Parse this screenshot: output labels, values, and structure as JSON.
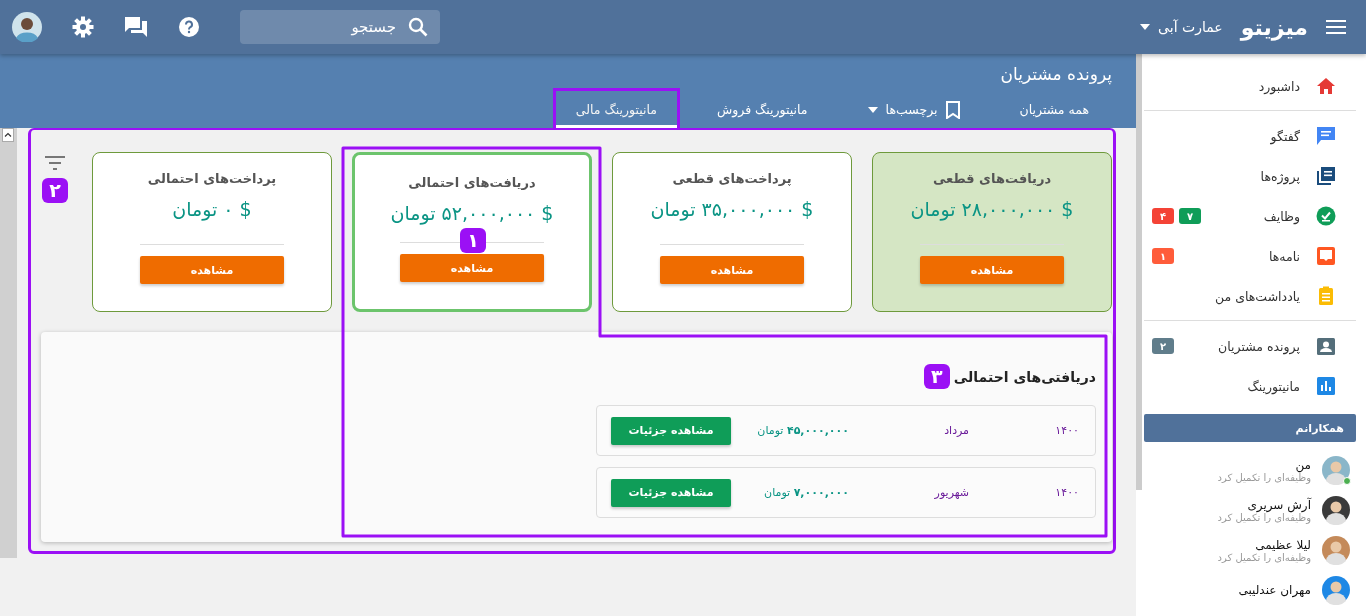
{
  "topbar": {
    "logo": "میزیتو",
    "workspace": "عمارت آبی",
    "search": {
      "placeholder": "جستجو"
    }
  },
  "page": {
    "title": "پرونده مشتریان",
    "tabs": [
      {
        "label": "همه مشتریان",
        "kind": "plain",
        "selected": false
      },
      {
        "label": "برچسب‌ها",
        "kind": "dropdown",
        "selected": false
      },
      {
        "label": "مانیتورینگ فروش",
        "kind": "plain",
        "selected": false
      },
      {
        "label": "مانیتورینگ مالی",
        "kind": "plain",
        "selected": true
      }
    ]
  },
  "cards": [
    {
      "title": "دریافت‌های قطعی",
      "amount": "$ ۲۸,۰۰۰,۰۰۰ تومان",
      "button": "مشاهده",
      "kind": "filled"
    },
    {
      "title": "پرداخت‌های قطعی",
      "amount": "$ ۳۵,۰۰۰,۰۰۰ تومان",
      "button": "مشاهده",
      "kind": "plain"
    },
    {
      "title": "دریافت‌های احتمالی",
      "amount": "$ ۵۲,۰۰۰,۰۰۰ تومان",
      "button": "مشاهده",
      "kind": "focused"
    },
    {
      "title": "پرداخت‌های احتمالی",
      "amount": "$ ۰ تومان",
      "button": "مشاهده",
      "kind": "plain"
    }
  ],
  "details": {
    "title": "دریافتی‌های احتمالی",
    "rows": [
      {
        "year": "۱۴۰۰",
        "month": "مرداد",
        "amount": "**۴۵,۰۰۰,۰۰۰** تومان",
        "button": "مشاهده جزئیات"
      },
      {
        "year": "۱۴۰۰",
        "month": "شهریور",
        "amount": "**۷,۰۰۰,۰۰۰** تومان",
        "button": "مشاهده جزئیات"
      }
    ]
  },
  "annotations": [
    {
      "label": "۱"
    },
    {
      "label": "۲"
    },
    {
      "label": "۳"
    }
  ],
  "sidebar": {
    "groups": [
      [
        {
          "label": "داشبورد"
        }
      ],
      [
        {
          "label": "گفتگو"
        },
        {
          "label": "پروژه‌ها"
        },
        {
          "label": "وظایف",
          "badges": [
            {
              "text": "۷",
              "color": "#0f9d58"
            },
            {
              "text": "۴",
              "color": "#f44336"
            }
          ]
        },
        {
          "label": "نامه‌ها",
          "badges": [
            {
              "text": "۱",
              "color": "#ff5c3a"
            }
          ]
        },
        {
          "label": "یادداشت‌های من"
        }
      ],
      [
        {
          "label": "پرونده مشتریان",
          "badges": [
            {
              "text": "۲",
              "color": "#607d8b"
            }
          ]
        },
        {
          "label": "مانیتورینگ"
        }
      ]
    ],
    "colleagues_title": "همکارانم",
    "colleagues": [
      {
        "name": "من",
        "status": "وظیفه‌ای را تکمیل کرد",
        "online": true
      },
      {
        "name": "آرش سریری",
        "status": "وظیفه‌ای را تکمیل کرد",
        "online": false
      },
      {
        "name": "لیلا عظیمی",
        "status": "وظیفه‌ای را تکمیل کرد",
        "online": false
      },
      {
        "name": "مهران عندلیبی",
        "online": false
      }
    ]
  }
}
